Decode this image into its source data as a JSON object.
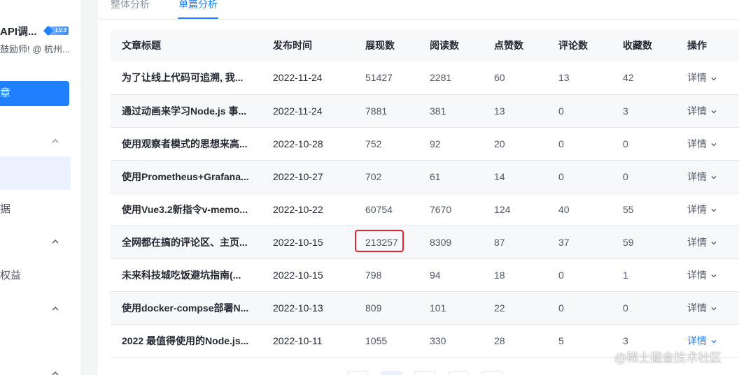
{
  "sidebar": {
    "user_name": "API调...",
    "level": "LV.3",
    "user_desc": "鼓励师! @ 杭州...",
    "active_menu": "章",
    "data_label": "据",
    "rights_label": "权益"
  },
  "tabs": [
    {
      "label": "整体分析"
    },
    {
      "label": "单篇分析"
    }
  ],
  "table": {
    "headers": [
      "文章标题",
      "发布时间",
      "展现数",
      "阅读数",
      "点赞数",
      "评论数",
      "收藏数",
      "操作"
    ],
    "rows": [
      {
        "title": "为了让线上代码可追溯, 我...",
        "date": "2022-11-24",
        "views": "51427",
        "reads": "2281",
        "likes": "60",
        "comments": "13",
        "favorites": "42",
        "action": "详情"
      },
      {
        "title": "通过动画来学习Node.js 事...",
        "date": "2022-11-24",
        "views": "7881",
        "reads": "381",
        "likes": "13",
        "comments": "0",
        "favorites": "3",
        "action": "详情"
      },
      {
        "title": "使用观察者模式的思想来高...",
        "date": "2022-10-28",
        "views": "752",
        "reads": "92",
        "likes": "20",
        "comments": "0",
        "favorites": "0",
        "action": "详情"
      },
      {
        "title": "使用Prometheus+Grafana...",
        "date": "2022-10-27",
        "views": "702",
        "reads": "61",
        "likes": "14",
        "comments": "0",
        "favorites": "0",
        "action": "详情"
      },
      {
        "title": "使用Vue3.2新指令v-memo...",
        "date": "2022-10-22",
        "views": "60754",
        "reads": "7670",
        "likes": "124",
        "comments": "40",
        "favorites": "55",
        "action": "详情"
      },
      {
        "title": "全网都在搞的评论区、主页...",
        "date": "2022-10-15",
        "views": "213257",
        "reads": "8309",
        "likes": "87",
        "comments": "37",
        "favorites": "59",
        "action": "详情"
      },
      {
        "title": "未来科技城吃饭避坑指南(...",
        "date": "2022-10-15",
        "views": "798",
        "reads": "94",
        "likes": "18",
        "comments": "0",
        "favorites": "1",
        "action": "详情"
      },
      {
        "title": "使用docker-compse部署N...",
        "date": "2022-10-13",
        "views": "809",
        "reads": "101",
        "likes": "22",
        "comments": "0",
        "favorites": "0",
        "action": "详情"
      },
      {
        "title": "2022 最值得使用的Node.js...",
        "date": "2022-10-11",
        "views": "1055",
        "reads": "330",
        "likes": "28",
        "comments": "5",
        "favorites": "3",
        "action": "详情"
      }
    ]
  },
  "watermark": "@稀土掘金技术社区",
  "colors": {
    "accent": "#1e80ff",
    "highlight_border": "#e8202f",
    "header_bg": "#f7f8fa"
  }
}
